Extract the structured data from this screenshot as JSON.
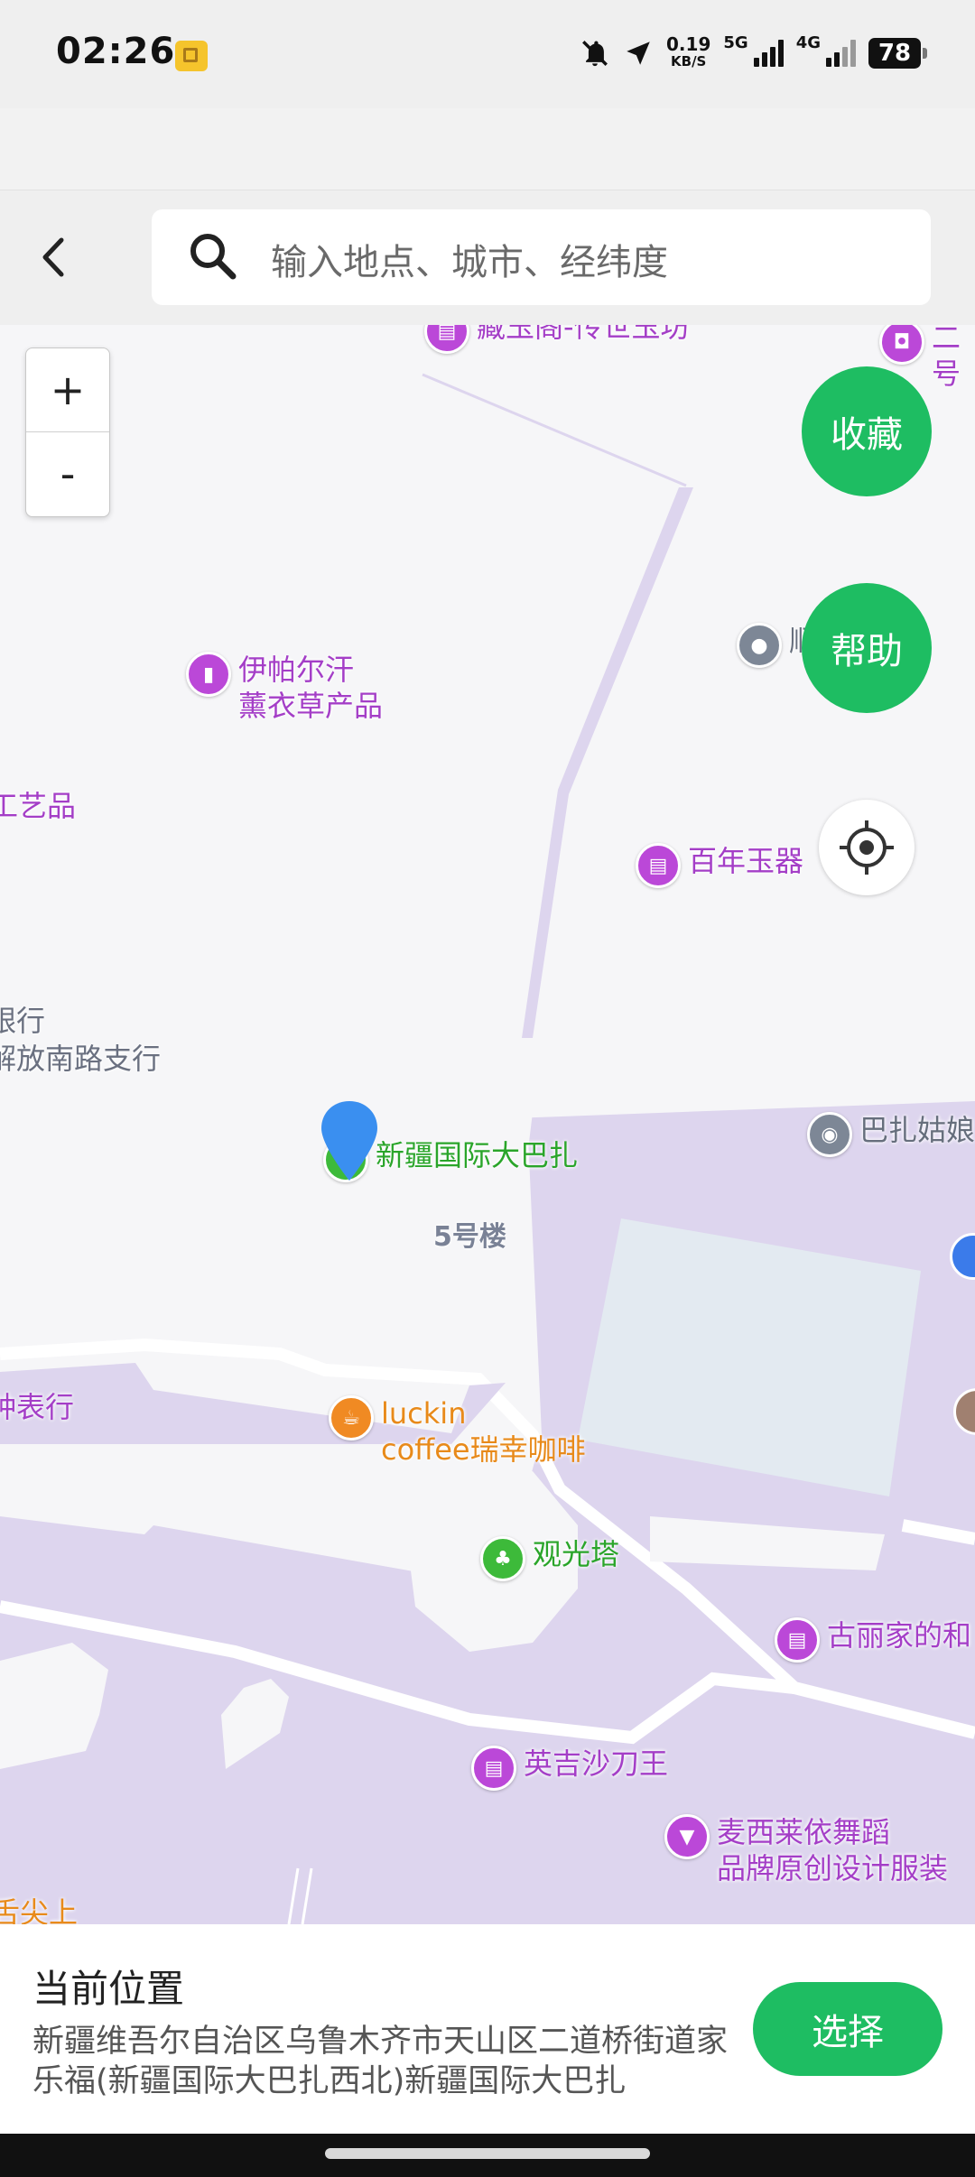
{
  "status_bar": {
    "time": "02:26",
    "speed_value": "0.19",
    "speed_unit": "KB/S",
    "net1": "5G",
    "net2": "4G",
    "battery": "78"
  },
  "search": {
    "placeholder": "输入地点、城市、经纬度"
  },
  "map": {
    "zoom_in": "+",
    "zoom_out": "-",
    "favorite_label": "收藏",
    "help_label": "帮助",
    "pois": {
      "p1": "藏玉阁-传世玉坊",
      "p2": "二号",
      "p3": "伊帕尔汗\n薰衣草产品",
      "p4": "工艺品",
      "p5": "百年玉器",
      "p6": "顺",
      "p7": "银行\n解放南路支行",
      "p8": "新疆国际大巴扎",
      "p9": "巴扎姑娘",
      "p10": "5号楼",
      "p11": "钟表行",
      "p12": "luckin\ncoffee瑞幸咖啡",
      "p13": "观光塔",
      "p14": "古丽家的和",
      "p15": "英吉沙刀王",
      "p16": "麦西莱依舞蹈\n品牌原创设计服装",
      "p17": "舌尖上"
    }
  },
  "panel": {
    "title": "当前位置",
    "address": "新疆维吾尔自治区乌鲁木齐市天山区二道桥街道家乐福(新疆国际大巴扎西北)新疆国际大巴扎",
    "select_label": "选择"
  },
  "colors": {
    "accent": "#1ebd62",
    "poi_purple": "#a43ec7",
    "poi_green": "#2aa52a",
    "poi_orange": "#e88a1a",
    "area_purple": "#ddd5ee"
  }
}
